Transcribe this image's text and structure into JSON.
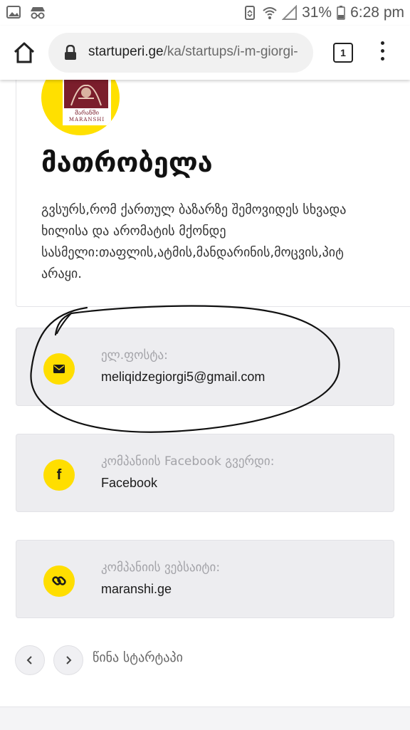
{
  "status_bar": {
    "battery": "31%",
    "time": "6:28 pm"
  },
  "browser": {
    "url_domain": "startuperi.ge",
    "url_path": "/ka/startups/i-m-giorgi-",
    "tab_count": "1"
  },
  "startup": {
    "logo_text": "მარანში",
    "logo_text_latin": "MARANSHI",
    "title": "მათრობელა",
    "description_lines": [
      "გვსურს,რომ ქართულ ბაზარზე შემოვიდეს სხვადა",
      "ხილისა და არომატის მქონდე",
      "სასმელი:თაფლის,ატმის,მანდარინის,მოცვის,პიტ",
      "არაყი."
    ]
  },
  "contacts": [
    {
      "icon": "envelope-icon",
      "label": "ელ.ფოსტა:",
      "value": "meliqidzegiorgi5@gmail.com"
    },
    {
      "icon": "facebook-icon",
      "label": "კომპანიის Facebook გვერდი:",
      "value": "Facebook"
    },
    {
      "icon": "link-icon",
      "label": "კომპანიის ვებსაიტი:",
      "value": "maranshi.ge"
    }
  ],
  "pagination": {
    "label": "წინა სტარტაპი"
  },
  "colors": {
    "accent_yellow": "#ffde00",
    "card_bg": "#ededf0",
    "logo_burgundy": "#7b1e2c"
  }
}
